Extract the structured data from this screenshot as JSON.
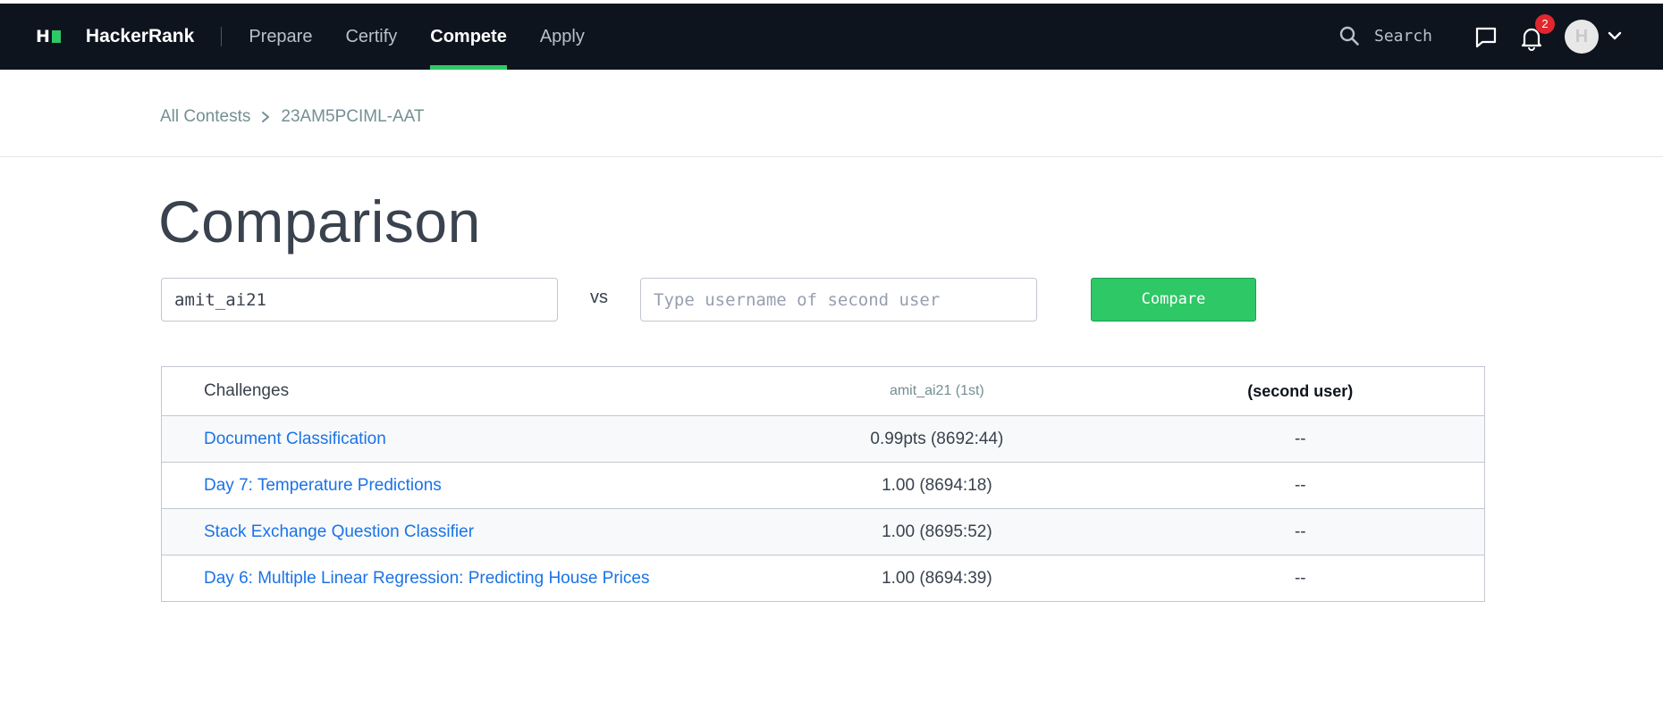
{
  "nav": {
    "logo_letter": "H",
    "brand": "HackerRank",
    "links": [
      {
        "label": "Prepare",
        "active": false
      },
      {
        "label": "Certify",
        "active": false
      },
      {
        "label": "Compete",
        "active": true
      },
      {
        "label": "Apply",
        "active": false
      }
    ],
    "search_placeholder": "Search",
    "notification_count": "2",
    "avatar_initial": "H",
    "icons": [
      "search-icon",
      "chat-icon",
      "bell-icon",
      "chevron-down-icon"
    ]
  },
  "breadcrumb": {
    "items": [
      "All Contests",
      "23AM5PCIML-AAT"
    ]
  },
  "page": {
    "title": "Comparison",
    "first_user_value": "amit_ai21",
    "vs_label": "vs",
    "second_user_placeholder": "Type username of second user",
    "compare_label": "Compare"
  },
  "table": {
    "headers": [
      "Challenges",
      "amit_ai21 (1st)",
      "(second user)"
    ],
    "rows": [
      {
        "challenge": "Document Classification",
        "user1": "0.99pts (8692:44)",
        "user2": "--"
      },
      {
        "challenge": "Day 7: Temperature Predictions",
        "user1": "1.00 (8694:18)",
        "user2": "--"
      },
      {
        "challenge": "Stack Exchange Question Classifier",
        "user1": "1.00 (8695:52)",
        "user2": "--"
      },
      {
        "challenge": "Day 6: Multiple Linear Regression: Predicting House Prices",
        "user1": "1.00 (8694:39)",
        "user2": "--"
      }
    ]
  },
  "colors": {
    "nav_bg": "#0e141e",
    "accent_green": "#2ec866",
    "link_blue": "#1a73e8",
    "badge_red": "#e1262d"
  }
}
